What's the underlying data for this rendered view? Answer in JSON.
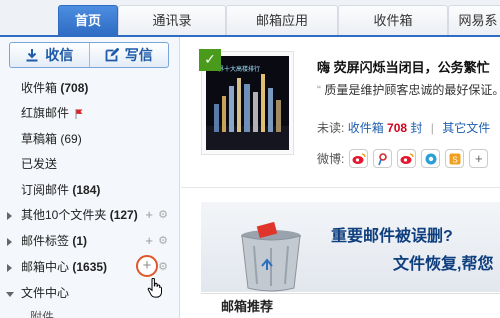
{
  "tabs": [
    {
      "label": "首页",
      "active": true
    },
    {
      "label": "通讯录",
      "active": false
    },
    {
      "label": "邮箱应用",
      "active": false
    },
    {
      "label": "收件箱",
      "active": false
    },
    {
      "label": "网易系",
      "active": false
    }
  ],
  "sidebar": {
    "receive_label": "收信",
    "compose_label": "写信",
    "items": [
      {
        "label": "收件箱",
        "count": "(708)",
        "bold_count": true
      },
      {
        "label": "红旗邮件",
        "count": "",
        "flag": true
      },
      {
        "label": "草稿箱",
        "count": "(69)",
        "bold_count": false
      },
      {
        "label": "已发送",
        "count": ""
      },
      {
        "label": "订阅邮件",
        "count": "(184)",
        "bold_count": true
      },
      {
        "label": "其他10个文件夹",
        "count": "(127)",
        "bold_count": true,
        "expandable": true
      },
      {
        "label": "邮件标签",
        "count": "(1)",
        "bold_count": true,
        "expandable": true
      },
      {
        "label": "邮箱中心",
        "count": "(1635)",
        "bold_count": true,
        "expandable": true
      },
      {
        "label": "文件中心",
        "count": "",
        "expanded": true
      },
      {
        "label": "附件",
        "count": ""
      }
    ],
    "add_glyph": "+",
    "gear_glyph": "⚙"
  },
  "main": {
    "stamp_caption": "世界十大高楼排行",
    "headline": "嗨 荧屏闪烁当闭目，公务繁忙",
    "quote": "质量是维护顾客忠诚的最好保证。",
    "unread_label": "未读:",
    "inbox_link": "收件箱",
    "inbox_count": "708",
    "inbox_unit": "封",
    "other_link": "其它文件",
    "weibo_label": "微博:",
    "weibo_icons": [
      "sina-weibo-icon",
      "tencent-weibo-icon",
      "sina-weibo-icon",
      "netease-weibo-icon",
      "sohu-weibo-icon",
      "add-icon"
    ],
    "banner_title": "重要邮件被误删?",
    "banner_sub": "文件恢复,帮您",
    "recommend_title": "邮箱推荐"
  },
  "colors": {
    "tab_active": "#2f6cc4",
    "highlight_ring": "#e0562a",
    "unread_number": "#d0021b",
    "link": "#1f5fb0"
  }
}
